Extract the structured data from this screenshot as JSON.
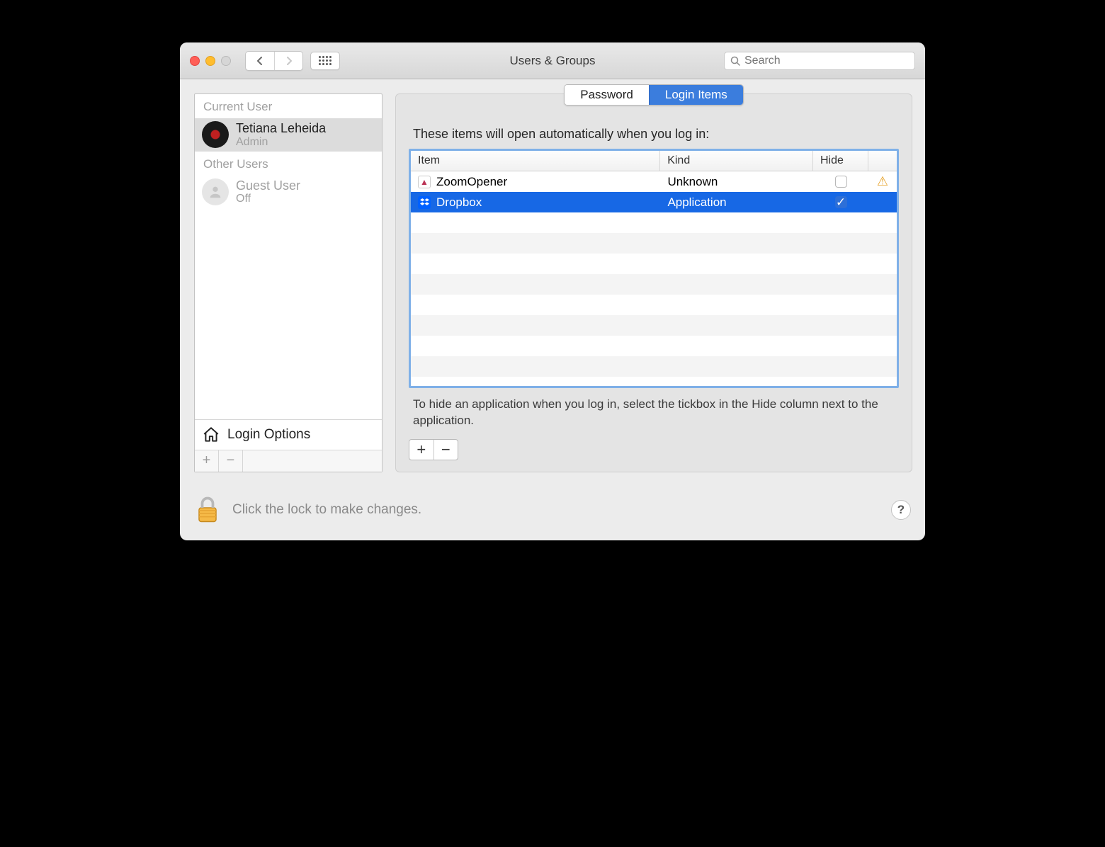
{
  "window": {
    "title": "Users & Groups"
  },
  "toolbar": {
    "search_placeholder": "Search"
  },
  "sidebar": {
    "current_user_label": "Current User",
    "other_users_label": "Other Users",
    "current_user": {
      "name": "Tetiana Leheida",
      "role": "Admin"
    },
    "other_users": [
      {
        "name": "Guest User",
        "status": "Off"
      }
    ],
    "login_options_label": "Login Options"
  },
  "tabs": {
    "password": "Password",
    "login_items": "Login Items"
  },
  "main": {
    "intro": "These items will open automatically when you log in:",
    "columns": {
      "item": "Item",
      "kind": "Kind",
      "hide": "Hide"
    },
    "login_items": [
      {
        "name": "ZoomOpener",
        "kind": "Unknown",
        "hide": false,
        "warning": true,
        "icon": "zoom",
        "selected": false
      },
      {
        "name": "Dropbox",
        "kind": "Application",
        "hide": true,
        "warning": false,
        "icon": "dropbox",
        "selected": true
      }
    ],
    "hint": "To hide an application when you log in, select the tickbox in the Hide column next to the application."
  },
  "footer": {
    "lock_text": "Click the lock to make changes.",
    "help_symbol": "?"
  }
}
